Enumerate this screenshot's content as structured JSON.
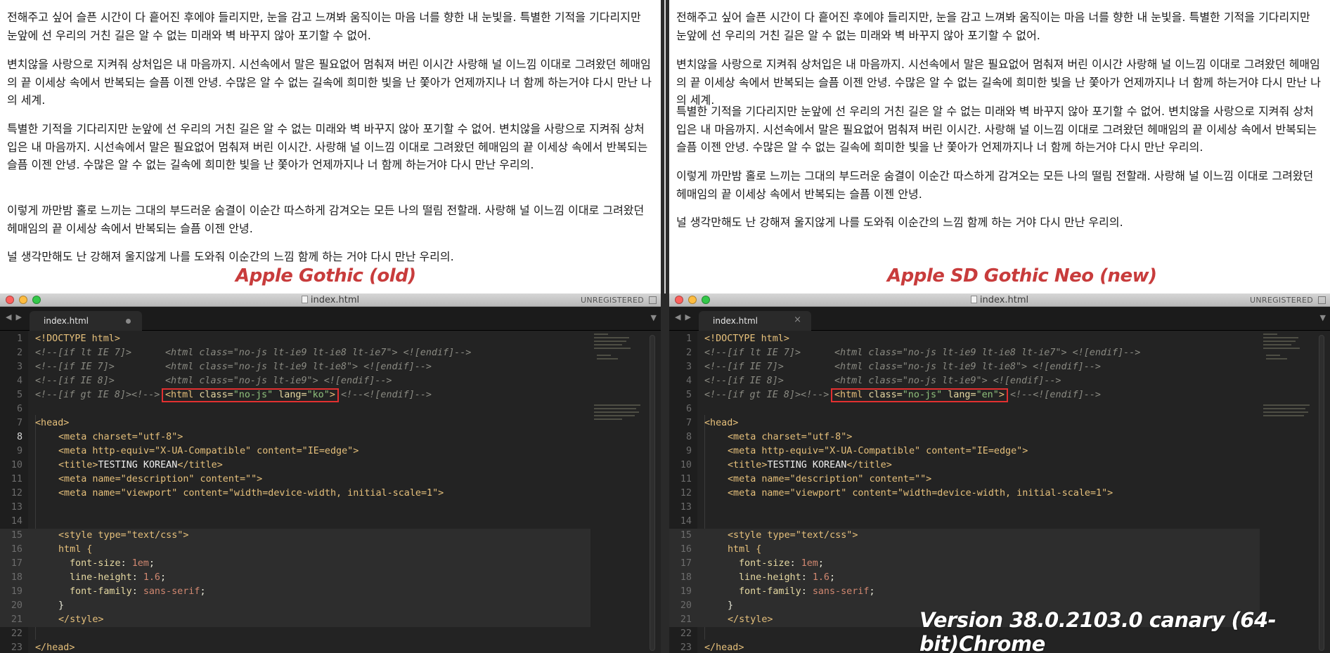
{
  "panes": [
    {
      "caption": "Apple Gothic (old)",
      "paragraphs": [
        "전해주고 싶어 슬픈 시간이 다 흩어진 후에야 들리지만, 눈을 감고 느껴봐 움직이는 마음 너를 향한 내 눈빛을. 특별한 기적을 기다리지만 눈앞에 선 우리의 거친 길은 알 수 없는 미래와 벽 바꾸지 않아 포기할 수 없어.",
        "변치않을 사랑으로 지켜줘 상처입은 내 마음까지. 시선속에서 말은 필요없어 멈춰져 버린 이시간 사랑해 널 이느낌 이대로 그려왔던 헤매임의 끝 이세상 속에서 반복되는 슬픔 이젠 안녕. 수많은 알 수 없는 길속에 희미한 빛을 난 쫓아가 언제까지나 너 함께 하는거야 다시 만난 나의 세계.",
        "특별한 기적을 기다리지만 눈앞에 선 우리의 거친 길은 알 수 없는 미래와 벽 바꾸지 않아 포기할 수 없어. 변치않을 사랑으로 지켜줘 상처입은 내 마음까지. 시선속에서 말은 필요없어 멈춰져 버린 이시간. 사랑해 널 이느낌 이대로 그려왔던 헤매임의 끝 이세상 속에서 반복되는 슬픔 이젠 안녕. 수많은 알 수 없는 길속에 희미한 빛을 난 쫓아가 언제까지나 너 함께 하는거야 다시 만난 우리의.",
        "이렇게 까만밤 홀로 느끼는 그대의 부드러운 숨결이 이순간 따스하게 감겨오는 모든 나의 떨림 전할래. 사랑해 널 이느낌 이대로 그려왔던 헤매임의 끝 이세상 속에서 반복되는 슬픔 이젠 안녕.",
        "널 생각만해도 난 강해져 울지않게 나를 도와줘 이순간의 느낌 함께 하는 거야 다시 만난 우리의."
      ],
      "window_title": "index.html",
      "unregistered": "UNREGISTERED",
      "tab_label": "index.html",
      "lang": "ko"
    },
    {
      "caption": "Apple SD Gothic Neo (new)",
      "paragraphs": [
        "전해주고 싶어 슬픈 시간이 다 흩어진 후에야 들리지만, 눈을 감고 느껴봐 움직이는 마음 너를 향한 내 눈빛을. 특별한 기적을 기다리지만 눈앞에 선 우리의 거친 길은 알 수 없는 미래와 벽 바꾸지 않아 포기할 수 없어.",
        "변치않을 사랑으로 지켜줘 상처입은 내 마음까지. 시선속에서 말은 필요없어 멈춰져 버린 이시간 사랑해 널 이느낌 이대로 그려왔던 헤매임의 끝 이세상 속에서 반복되는 슬픔 이젠 안녕. 수많은 알 수 없는 길속에 희미한 빛을 난 쫓아가 언제까지나 너 함께 하는거야 다시 만난 나의 세계.",
        "특별한 기적을 기다리지만 눈앞에 선 우리의 거친 길은 알 수 없는 미래와 벽 바꾸지 않아 포기할 수 없어. 변치않을 사랑으로 지켜줘 상처입은 내 마음까지. 시선속에서 말은 필요없어 멈춰져 버린 이시간. 사랑해 널 이느낌 이대로 그려왔던 헤매임의 끝 이세상 속에서 반복되는 슬픔 이젠 안녕. 수많은 알 수 없는 길속에 희미한 빛을 난 쫓아가 언제까지나 너 함께 하는거야 다시 만난 우리의.",
        "이렇게 까만밤 홀로 느끼는 그대의 부드러운 숨결이 이순간 따스하게 감겨오는 모든 나의 떨림 전할래. 사랑해 널 이느낌 이대로 그려왔던 헤매임의 끝 이세상 속에서 반복되는 슬픔 이젠 안녕.",
        "널 생각만해도 난 강해져 울지않게 나를 도와줘 이순간의 느낌 함께 하는 거야 다시 만난 우리의."
      ],
      "window_title": "index.html",
      "unregistered": "UNREGISTERED",
      "tab_label": "index.html",
      "lang": "en"
    }
  ],
  "code": {
    "doctype": "<!DOCTYPE html>",
    "l2_cmt": "<!--[if lt IE 7]>",
    "l2_html": "<html class=\"no-js lt-ie9 lt-ie8 lt-ie7\"> <![endif]-->",
    "l3_cmt": "<!--[if IE 7]>",
    "l3_html": "<html class=\"no-js lt-ie9 lt-ie8\"> <![endif]-->",
    "l4_cmt": "<!--[if IE 8]>",
    "l4_html": "<html class=\"no-js lt-ie9\"> <![endif]-->",
    "l5_cmt": "<!--[if gt IE 8]><!-->",
    "l5_end": "<!--<![endif]-->",
    "head_open": "<head>",
    "meta_charset": "<meta charset=\"utf-8\">",
    "meta_xua": "<meta http-equiv=\"X-UA-Compatible\" content=\"IE=edge\">",
    "title_open": "<title>",
    "title_text": "TESTING KOREAN",
    "title_close": "</title>",
    "meta_desc": "<meta name=\"description\" content=\"\">",
    "meta_viewport": "<meta name=\"viewport\" content=\"width=device-width, initial-scale=1\">",
    "style_open": "<style type=\"text/css\">",
    "css_html": "html {",
    "css_fs_prop": "font-size",
    "css_fs_val": "1em",
    "css_lh_prop": "line-height",
    "css_lh_val": "1.6",
    "css_ff_prop": "font-family",
    "css_ff_val": "sans-serif",
    "css_close": "}",
    "style_close": "</style>",
    "head_close": "</head>"
  },
  "line_numbers": [
    "1",
    "2",
    "3",
    "4",
    "5",
    "6",
    "7",
    "8",
    "9",
    "10",
    "11",
    "12",
    "13",
    "14",
    "15",
    "16",
    "17",
    "18",
    "19",
    "20",
    "21",
    "22",
    "23"
  ],
  "chrome_caption": "Version 38.0.2103.0 canary (64-bit)Chrome"
}
